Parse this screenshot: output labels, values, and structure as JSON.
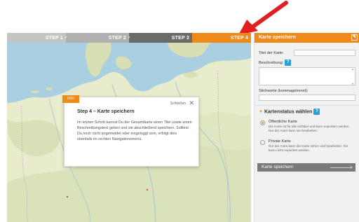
{
  "colors": {
    "accent": "#ef8a1a",
    "arrow": "#e02020",
    "help": "#2aa0d8"
  },
  "steps": [
    {
      "label": "STEP 1",
      "state": "done"
    },
    {
      "label": "STEP 2",
      "state": "done"
    },
    {
      "label": "STEP 3",
      "state": "done"
    },
    {
      "label": "STEP 4",
      "state": "active"
    }
  ],
  "dialog": {
    "tag": "Info",
    "close_label": "Schließen",
    "close_icon": "close-icon",
    "title": "Step 4  –  Karte speichern",
    "text": "Im letzten Schritt kannst Du der Gesamtkarte einen Titel sowie einen Beschreibungstext geben und sie abschließend speichern. Solltest Du noch nicht angemeldet oder eingeloggt sein, erfolgt dies ebenfalls im rechten Navigationsmenü."
  },
  "panel": {
    "title": "Karte speichern",
    "title_label": "Titel der Karte:",
    "title_value": "",
    "description_label": "Beschreibung:",
    "description_value": "",
    "tags_label": "Stichworte (kommagetrennt):",
    "tags_value": "",
    "status_title": "Kartenstatus wählen",
    "options": [
      {
        "title": "Öffentliche Karte",
        "desc": "Die Karte ist für alle sichtbar und kann exportiert werden. Nur der Autor kann sie bearbeiten.",
        "selected": true
      },
      {
        "title": "Private Karte",
        "desc": "Nur der Autor kann die Karte sehen und bearbeiten. Sie kann nicht exportiert werden.",
        "selected": false
      }
    ],
    "save_label": "Karte speichern"
  }
}
